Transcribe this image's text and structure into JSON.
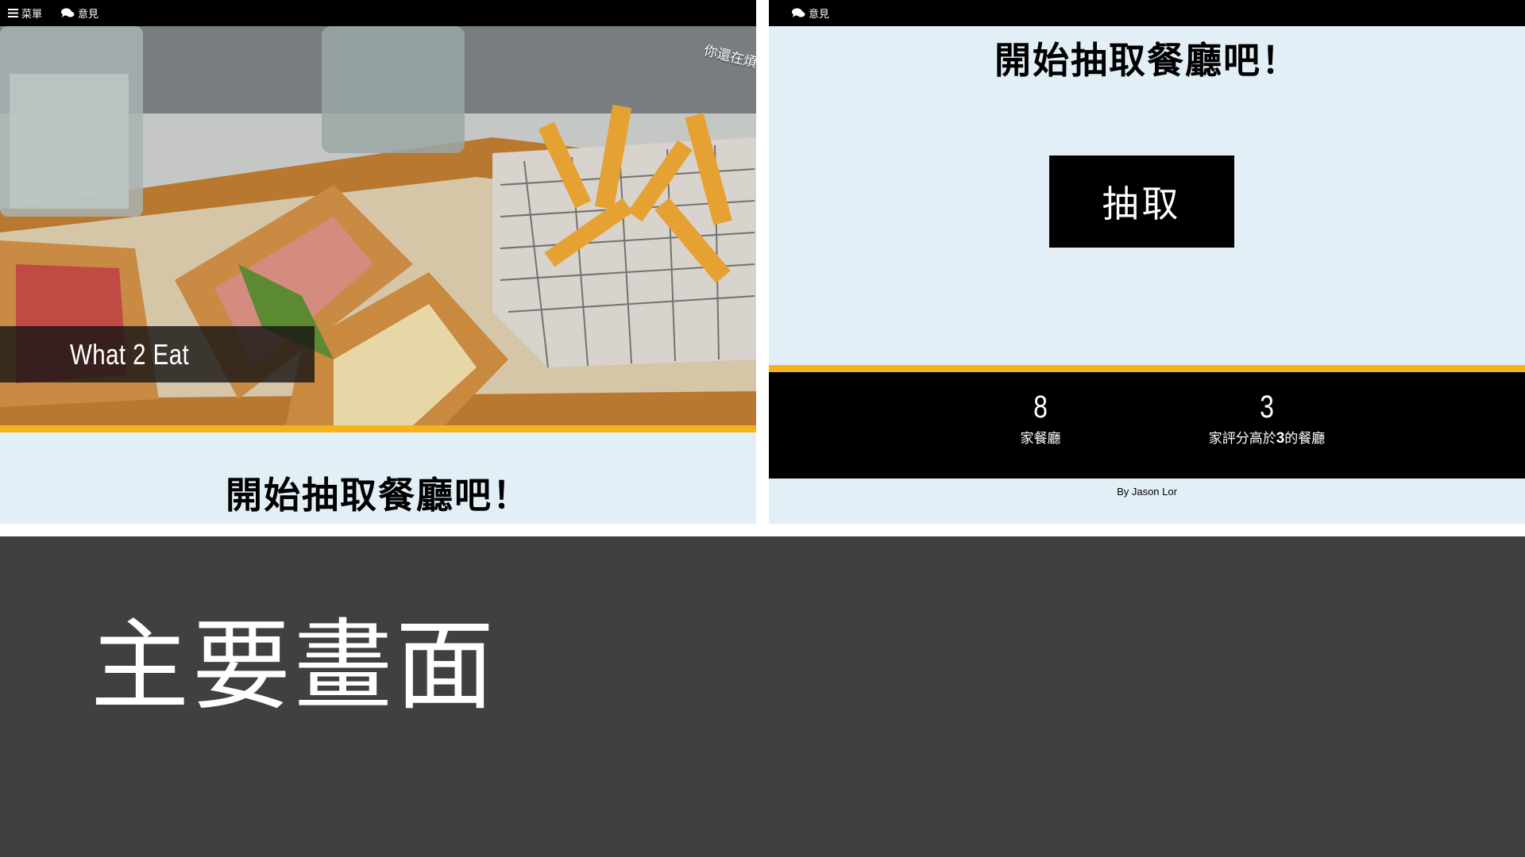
{
  "left_screen": {
    "nav": {
      "menu_label": "菜單",
      "feedback_label": "意見",
      "menu_icon": "hamburger-icon",
      "feedback_icon": "comments-icon"
    },
    "hero": {
      "marquee_text": "你還在煩",
      "title": "What 2 Eat"
    },
    "headline": "開始抽取餐廳吧！"
  },
  "right_screen": {
    "nav": {
      "feedback_label": "意見",
      "feedback_icon": "comments-icon"
    },
    "headline": "開始抽取餐廳吧！",
    "draw_button_label": "抽取",
    "stats": {
      "restaurant_count": "8",
      "restaurant_count_label": "家餐廳",
      "high_rated_count": "3",
      "high_rated_label_prefix": "家評分高於",
      "high_rated_threshold": "3",
      "high_rated_label_suffix": "的餐廳"
    },
    "credit": "By Jason Lor"
  },
  "caption": "主要畫面",
  "colors": {
    "accent_stripe": "#f5b21a",
    "page_background": "#e3eff7",
    "caption_background": "#404040"
  }
}
